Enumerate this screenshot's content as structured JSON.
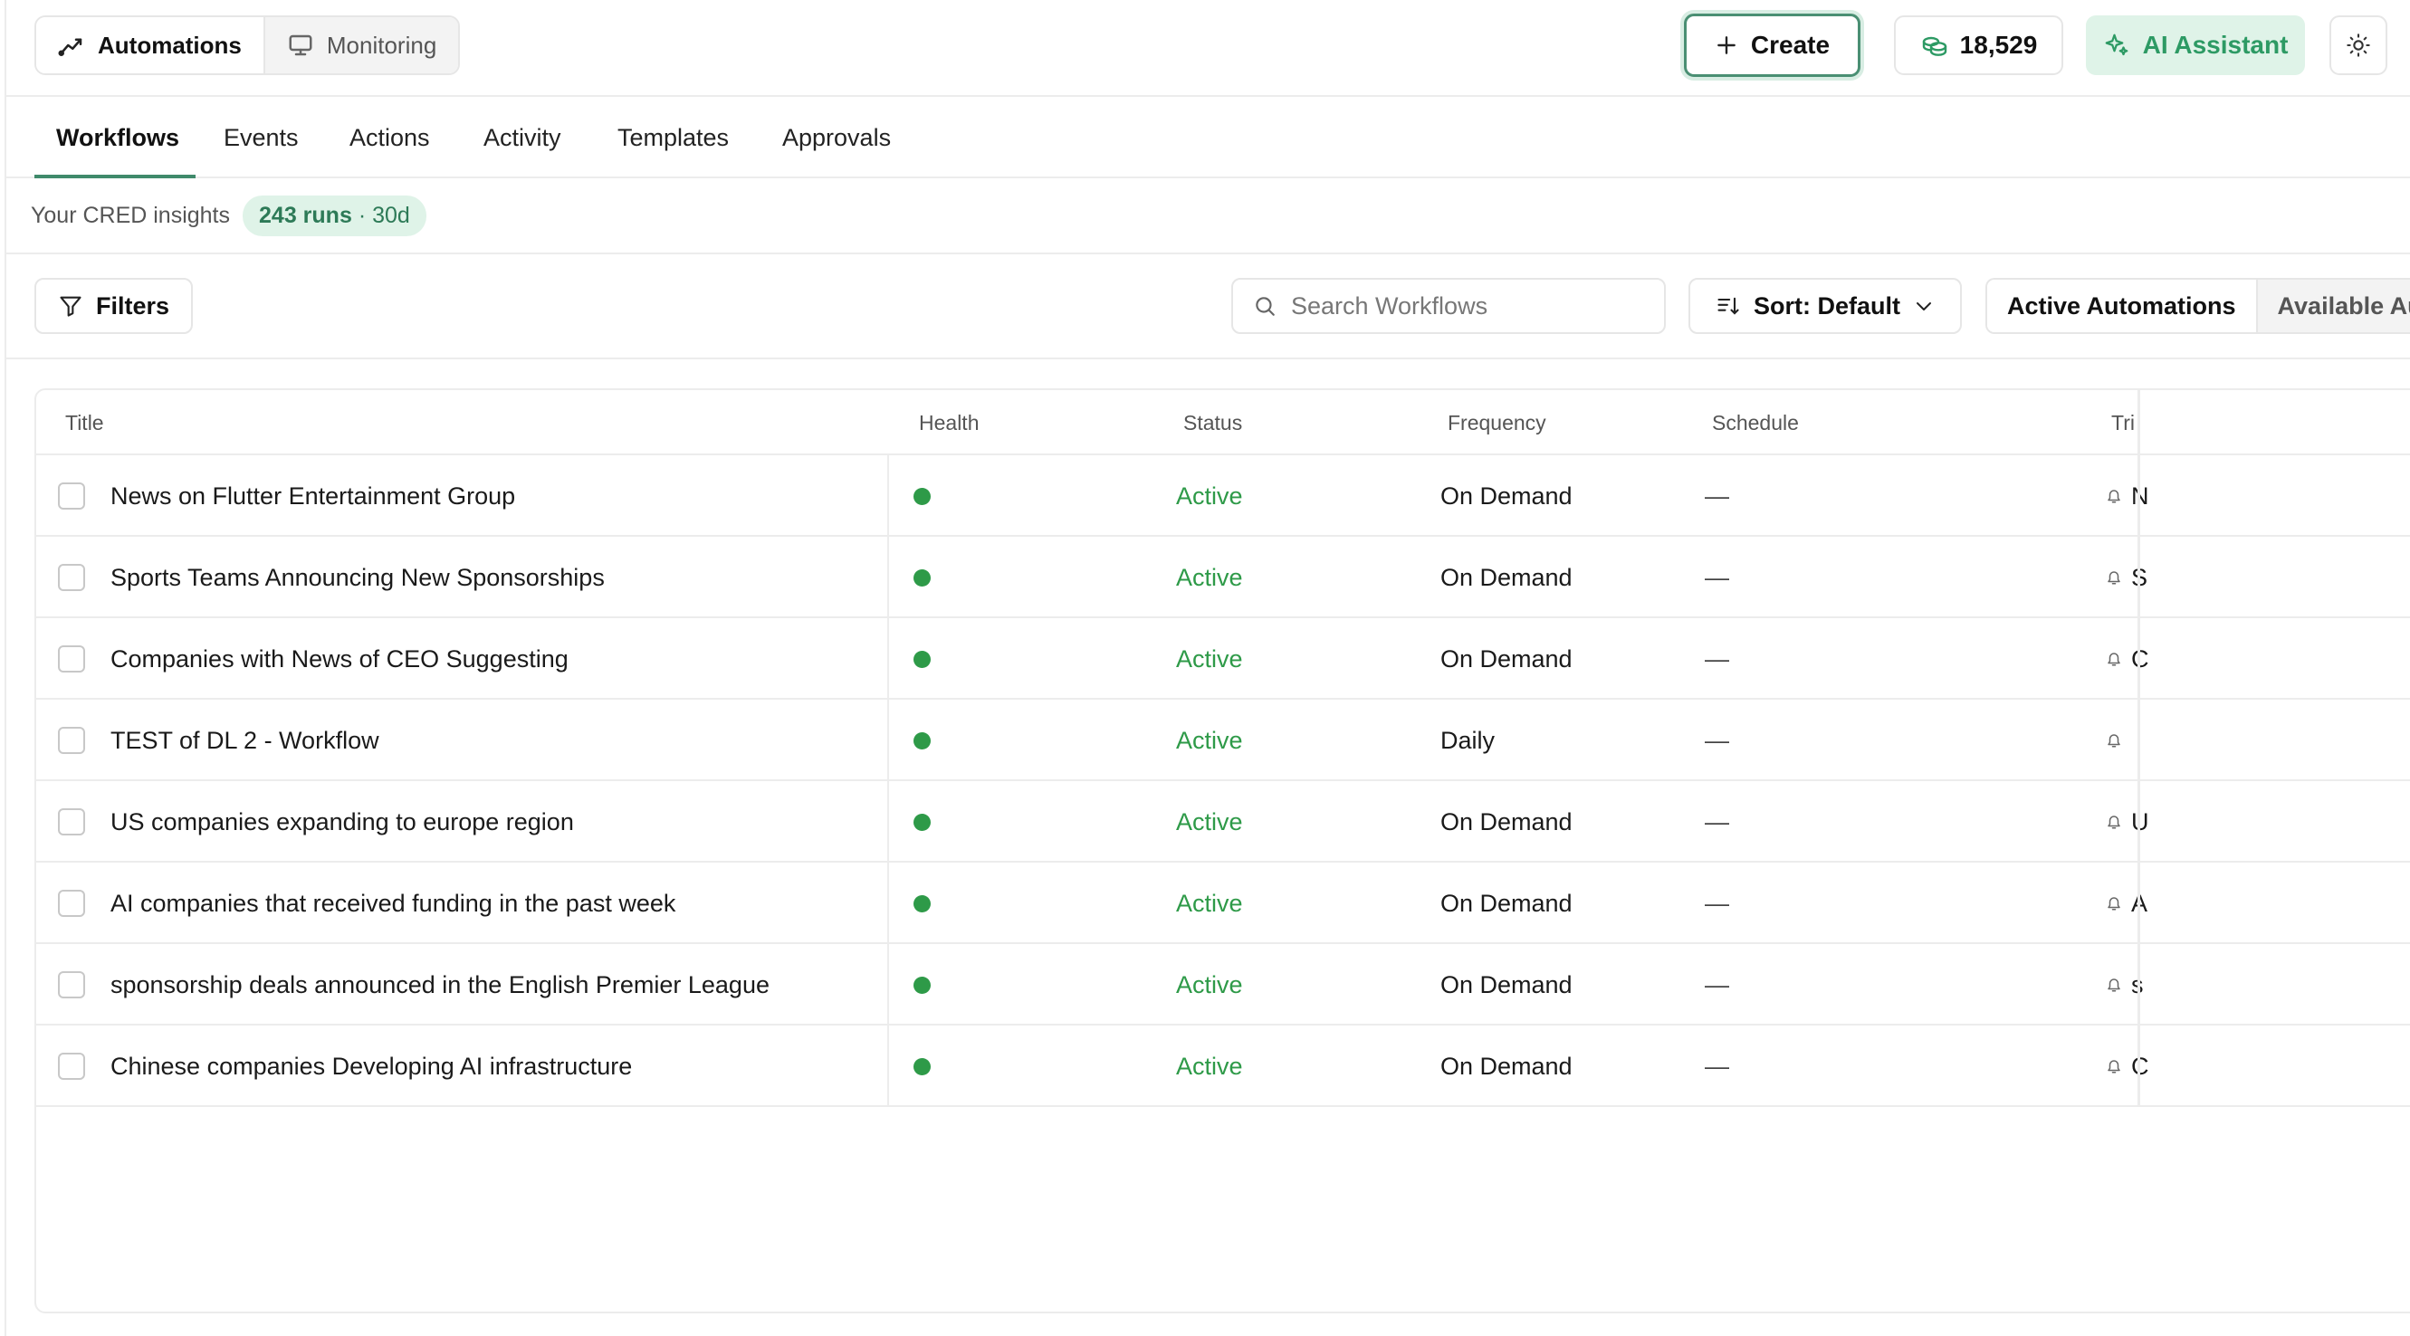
{
  "topbar": {
    "segments": [
      {
        "label": "Automations",
        "icon": "trend-line-icon",
        "active": true
      },
      {
        "label": "Monitoring",
        "icon": "monitor-icon",
        "active": false
      }
    ],
    "create_label": "Create",
    "credits": "18,529",
    "ai_label": "AI Assistant"
  },
  "tabs": [
    "Workflows",
    "Events",
    "Actions",
    "Activity",
    "Templates",
    "Approvals"
  ],
  "insights": {
    "label": "Your CRED insights",
    "runs": "243 runs",
    "period": "· 30d"
  },
  "toolbar": {
    "filters_label": "Filters",
    "search_placeholder": "Search Workflows",
    "sort_label": "Sort: Default",
    "views": [
      "Active Automations",
      "Available Aut"
    ]
  },
  "table": {
    "columns": [
      "Title",
      "Health",
      "Status",
      "Frequency",
      "Schedule",
      "Tri"
    ],
    "rows": [
      {
        "title": "News on Flutter Entertainment Group",
        "status": "Active",
        "frequency": "On Demand",
        "schedule": "—",
        "trigger": "N"
      },
      {
        "title": "Sports Teams Announcing New Sponsorships",
        "status": "Active",
        "frequency": "On Demand",
        "schedule": "—",
        "trigger": "S"
      },
      {
        "title": "Companies with News of CEO Suggesting",
        "status": "Active",
        "frequency": "On Demand",
        "schedule": "—",
        "trigger": "C"
      },
      {
        "title": "TEST of DL 2 - Workflow",
        "status": "Active",
        "frequency": "Daily",
        "schedule": "—",
        "trigger": ""
      },
      {
        "title": "US companies expanding to europe region",
        "status": "Active",
        "frequency": "On Demand",
        "schedule": "—",
        "trigger": "U"
      },
      {
        "title": "AI companies that received funding in the past week",
        "status": "Active",
        "frequency": "On Demand",
        "schedule": "—",
        "trigger": "A"
      },
      {
        "title": "sponsorship deals announced in the English Premier League",
        "status": "Active",
        "frequency": "On Demand",
        "schedule": "—",
        "trigger": "s"
      },
      {
        "title": "Chinese companies Developing AI infrastructure",
        "status": "Active",
        "frequency": "On Demand",
        "schedule": "—",
        "trigger": "C"
      }
    ]
  },
  "colors": {
    "accent": "#3f8a6b",
    "status_active": "#2e9a48",
    "ai_bg": "#dff3e8"
  }
}
